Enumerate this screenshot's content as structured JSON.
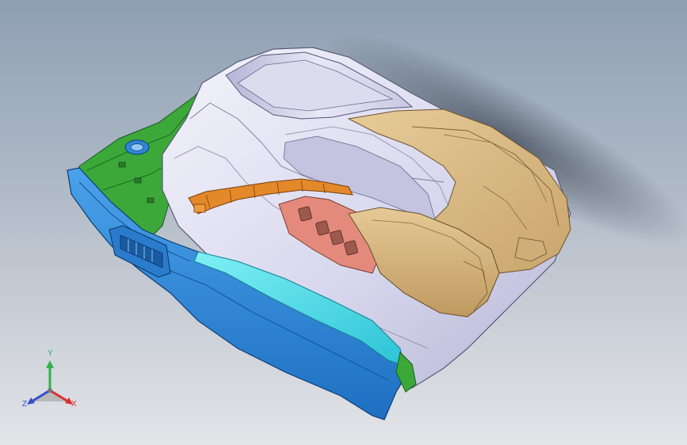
{
  "triad": {
    "x_label": "X",
    "y_label": "Y",
    "z_label": "Z",
    "x_color": "#d93030",
    "y_color": "#2fb24a",
    "z_color": "#3550c8"
  },
  "model": {
    "parts": [
      {
        "name": "door-trim-panel",
        "color": "#d8d8ee"
      },
      {
        "name": "upper-insert",
        "color": "#d9bb86"
      },
      {
        "name": "armrest",
        "color": "#d6b27a"
      },
      {
        "name": "switch-panel",
        "color": "#e48a7c"
      },
      {
        "name": "pull-handle-bracket",
        "color": "#e3892a"
      },
      {
        "name": "lower-trim",
        "color": "#2f86d6"
      },
      {
        "name": "sill-strip",
        "color": "#3fd9e6"
      },
      {
        "name": "support-bracket",
        "color": "#3ca83a"
      }
    ]
  }
}
